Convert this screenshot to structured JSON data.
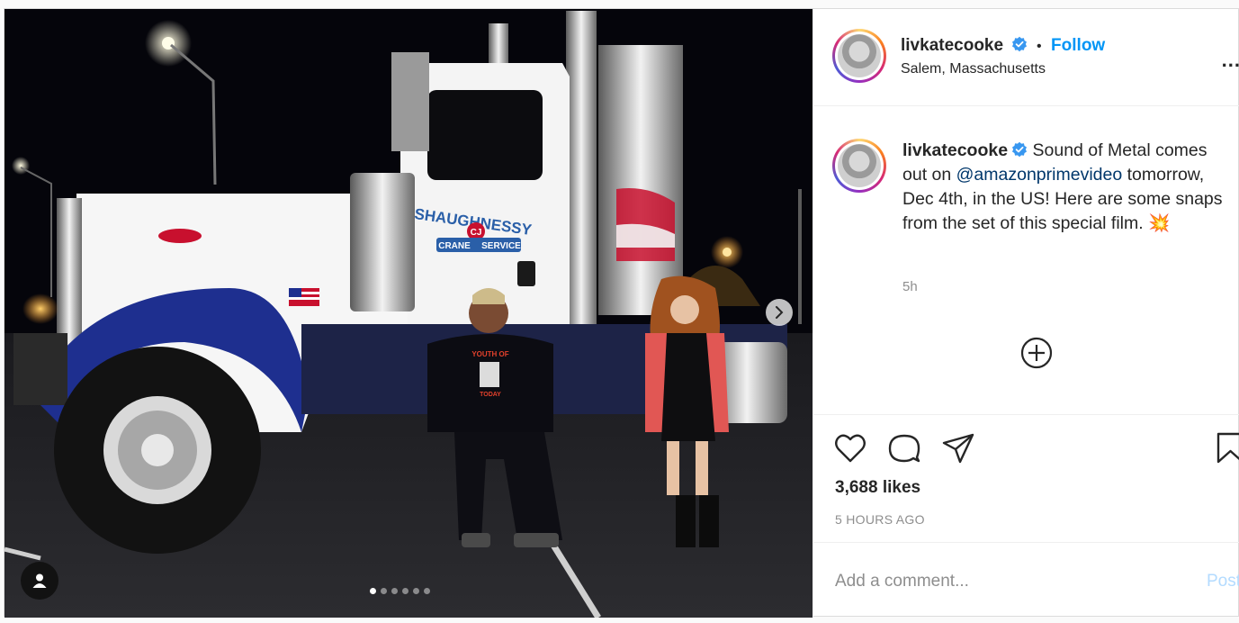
{
  "post": {
    "author": {
      "username": "livkatecooke",
      "verified": true,
      "follow_label": "Follow",
      "separator": "•",
      "location": "Salem, Massachusetts"
    },
    "more_label": "...",
    "caption": {
      "username": "livkatecooke",
      "text_before": " Sound of Metal comes out on ",
      "mention": "@amazonprimevideo",
      "text_after": " tomorrow, Dec 4th, in the US! Here are some snaps from the set of this special film. 💥",
      "time_ago": "5h"
    },
    "likes_label": "3,688 likes",
    "posted_label": "5 HOURS AGO",
    "comment": {
      "placeholder": "Add a comment...",
      "post_label": "Post"
    },
    "carousel": {
      "slide_count": 6,
      "active_index": 0
    },
    "truck_text": {
      "line1": "SHAUGHNESSY",
      "line2": "CRANE",
      "line3": "SERVICE",
      "badge": "CJ"
    },
    "shirt_text": {
      "top": "YOUTH OF",
      "bottom": "TODAY"
    },
    "colors": {
      "follow": "#0095f6",
      "verified": "#3897f0",
      "mention": "#00376b",
      "muted": "#8e8e8e"
    }
  }
}
